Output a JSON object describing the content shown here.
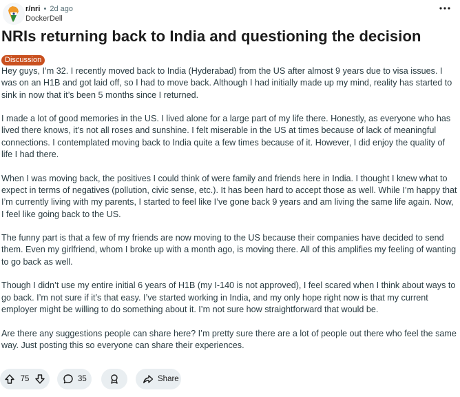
{
  "post": {
    "subreddit": "r/nri",
    "separator": "•",
    "time_ago": "2d ago",
    "author": "DockerDell",
    "title": "NRIs returning back to India and questioning the decision",
    "flair": "Discussion",
    "paragraphs": [
      "Hey guys, I’m 32. I recently moved back to India (Hyderabad) from the US after almost 9 years due to visa issues. I was on an H1B and got laid off, so I had to move back. Although I had initially made up my mind, reality has started to sink in now that it’s been 5 months since I returned.",
      "I made a lot of good memories in the US. I lived alone for a large part of my life there. Honestly, as everyone who has lived there knows, it’s not all roses and sunshine. I felt miserable in the US at times because of lack of meaningful connections. I contemplated moving back to India quite a few times because of it. However, I did enjoy the quality of life I had there.",
      "When I was moving back, the positives I could think of were family and friends here in India. I thought I knew what to expect in terms of negatives (pollution, civic sense, etc.). It has been hard to accept those as well. While I’m happy that I’m currently living with my parents, I started to feel like I’ve gone back 9 years and am living the same life again. Now, I feel like going back to the US.",
      "The funny part is that a few of my friends are now moving to the US because their companies have decided to send them. Even my girlfriend, whom I broke up with a month ago, is moving there. All of this amplifies my feeling of wanting to go back as well.",
      "Though I didn’t use my entire initial 6 years of H1B (my I-140 is not approved), I feel scared when I think about ways to go back. I’m not sure if it’s that easy. I’ve started working in India, and my only hope right now is that my current employer might be willing to do something about it. I’m not sure how straightforward that would be.",
      "Are there any suggestions people can share here? I’m pretty sure there are a lot of people out there who feel the same way. Just posting this so everyone can share their experiences."
    ]
  },
  "actions": {
    "upvotes": "75",
    "comments": "35",
    "share_label": "Share"
  },
  "icons": {
    "more": "ellipsis-icon",
    "upvote": "upvote-arrow-icon",
    "downvote": "downvote-arrow-icon",
    "comments": "comment-bubble-icon",
    "award": "award-icon",
    "share": "share-arrow-icon"
  },
  "colors": {
    "flair_bg": "#c9501f",
    "pill_bg": "#e9eef1",
    "body_text": "#2a3c42"
  }
}
